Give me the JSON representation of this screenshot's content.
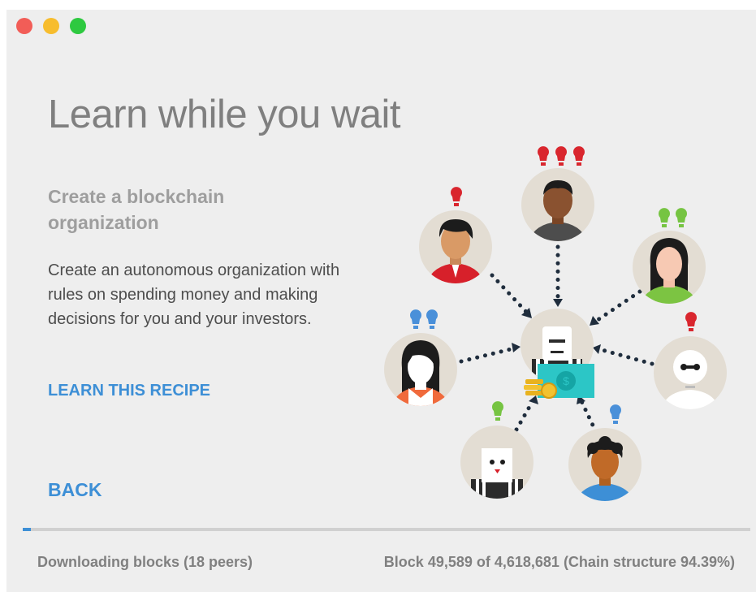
{
  "window": {
    "controls": [
      "close",
      "minimize",
      "maximize"
    ]
  },
  "page": {
    "title": "Learn while you wait"
  },
  "recipe": {
    "title": "Create a blockchain organization",
    "description": "Create an autonomous organization with rules on spending money and making decisions for you and your investors.",
    "link_label": "LEARN THIS RECIPE"
  },
  "nav": {
    "back_label": "BACK"
  },
  "status": {
    "downloading": "Downloading blocks (18 peers)",
    "block_info": "Block 49,589 of 4,618,681 (Chain structure 94.39%)",
    "progress_fraction": 0.0107
  },
  "illustration": {
    "icons": [
      "person-avatar",
      "robot-avatar",
      "lightbulb-icon",
      "money-bill-icon",
      "coin-stack-icon"
    ],
    "colors": {
      "accent": "#3d8fd6",
      "red": "#d9262e",
      "green": "#76c442",
      "blue": "#4a90d9",
      "teal": "#2cc6c6"
    }
  }
}
